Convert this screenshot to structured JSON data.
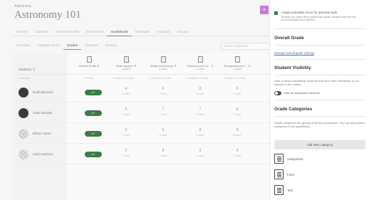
{
  "course": {
    "breadcrumb": "Astronomy",
    "title": "Astronomy 101"
  },
  "nav": [
    "Content",
    "Calendar",
    "Announcements",
    "Discussions",
    "Gradebook",
    "Messages",
    "Analytics",
    "Groups"
  ],
  "nav_active": 4,
  "subnav": [
    "Overview",
    "Gradable Items",
    "Grades",
    "Students",
    "Mastery"
  ],
  "subnav_active": 2,
  "search": {
    "placeholder": "Search gradebook"
  },
  "grid": {
    "students_header": "Students ⇕",
    "overall_header": "Overall Grade ⇕",
    "overall_sub": "# Points",
    "columns": [
      {
        "name": "Solar System ⇕",
        "pts": "1 point",
        "sub": "# Graded | # Posted"
      },
      {
        "name": "Stellar Astronomy ⇕",
        "pts": "1 point",
        "sub": "# Graded | # Posted"
      },
      {
        "name": "Galaxies and Co... ⇕",
        "pts": "1 point",
        "sub": "# Graded | # Posted"
      },
      {
        "name": "Exoplanets and ... ⇕",
        "pts": "1 point",
        "sub": "# Graded | # Posted"
      }
    ],
    "students_sub": "# Students",
    "rows": [
      {
        "name": "Noah Bennett",
        "grade": "A+",
        "cells": [
          {
            "v": "4",
            "s": "Posted"
          },
          {
            "v": "6",
            "s": "Posted"
          },
          {
            "v": "8",
            "s": "Posted"
          },
          {
            "v": "9",
            "s": "Posted"
          }
        ]
      },
      {
        "name": "Aiden Brooks",
        "grade": "A+",
        "cells": [
          {
            "v": "5",
            "s": "Posted"
          },
          {
            "v": "7",
            "s": "Posted"
          },
          {
            "v": "7",
            "s": "Posted"
          },
          {
            "v": "9",
            "s": "Posted"
          }
        ]
      },
      {
        "name": "Ethan Carter",
        "grade": "A+",
        "cells": [
          {
            "v": "5",
            "s": "Posted"
          },
          {
            "v": "6",
            "s": "Posted"
          },
          {
            "v": "8",
            "s": "Posted"
          },
          {
            "v": "9",
            "s": "Posted"
          }
        ]
      },
      {
        "name": "Liam Harrison",
        "grade": "A+",
        "cells": [
          {
            "v": "5",
            "s": "Posted"
          },
          {
            "v": "8",
            "s": "Posted"
          },
          {
            "v": "9",
            "s": "Posted"
          },
          {
            "v": "4",
            "s": "Posted"
          }
        ]
      }
    ]
  },
  "panel": {
    "close_icon": "×",
    "auto_zero": {
      "label": "Assign automatic zeros for past due work",
      "desc": "Students can submit late to update their grades. Students with due date accommodations aren't affected."
    },
    "overall": {
      "heading": "Overall Grade",
      "link": "Manage overall grade settings"
    },
    "visibility": {
      "heading": "Student Visibility",
      "text": "Hide or show unavailable students that have been withdrawn or not allowed in the course",
      "toggle_label": "Hide all unavailable students"
    },
    "categories": {
      "heading": "Grade Categories",
      "text": "Grade categories are groups of similar coursework. You can add custom categories to the gradebook.",
      "add_button": "Add New Category",
      "items": [
        "Assignment",
        "Form",
        "Test"
      ]
    }
  },
  "colors": {
    "accent": "#c77ad8",
    "grade_pill": "#3e7a45",
    "link": "#4a6fb0"
  }
}
